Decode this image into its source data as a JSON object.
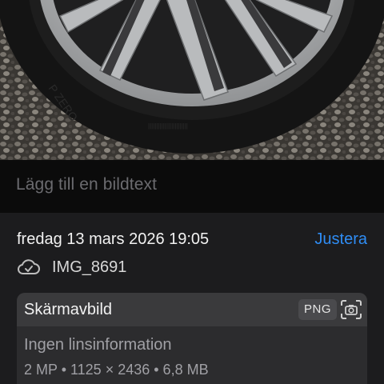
{
  "photo": {
    "subject": "car wheel and tire on gravel"
  },
  "caption": {
    "placeholder": "Lägg till en bildtext"
  },
  "info": {
    "date": "fredag 13 mars 2026 19:05",
    "adjust_label": "Justera",
    "filename": "IMG_8691",
    "cloud_icon": "cloud-check-icon"
  },
  "card": {
    "title": "Skärmavbild",
    "format_badge": "PNG",
    "camera_icon": "screenshot-camera-icon",
    "lens_info": "Ingen linsinformation",
    "specs": "2 MP • 1125 × 2436 • 6,8 MB"
  },
  "colors": {
    "accent": "#2f8df5",
    "background": "#1c1c1e",
    "card": "#2c2c2e"
  }
}
